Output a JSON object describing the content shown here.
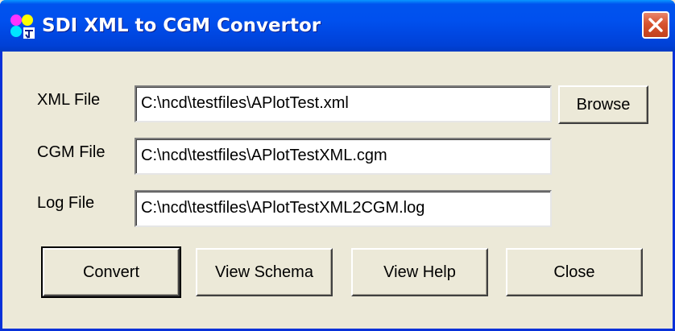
{
  "window": {
    "title": "SDI XML to CGM Convertor",
    "close_glyph": "✕"
  },
  "colors": {
    "titlebar_blue": "#0053ee",
    "close_red": "#d7532f",
    "face": "#ece9d8"
  },
  "icons": {
    "app": "cgm-convertor-icon",
    "close": "close-icon"
  },
  "fields": [
    {
      "label": "XML File",
      "value": "C:\\ncd\\testfiles\\APlotTest.xml"
    },
    {
      "label": "CGM File",
      "value": "C:\\ncd\\testfiles\\APlotTestXML.cgm"
    },
    {
      "label": "Log File",
      "value": "C:\\ncd\\testfiles\\APlotTestXML2CGM.log"
    }
  ],
  "buttons": {
    "browse": "Browse",
    "convert": "Convert",
    "view_schema": "View Schema",
    "view_help": "View Help",
    "close": "Close"
  }
}
